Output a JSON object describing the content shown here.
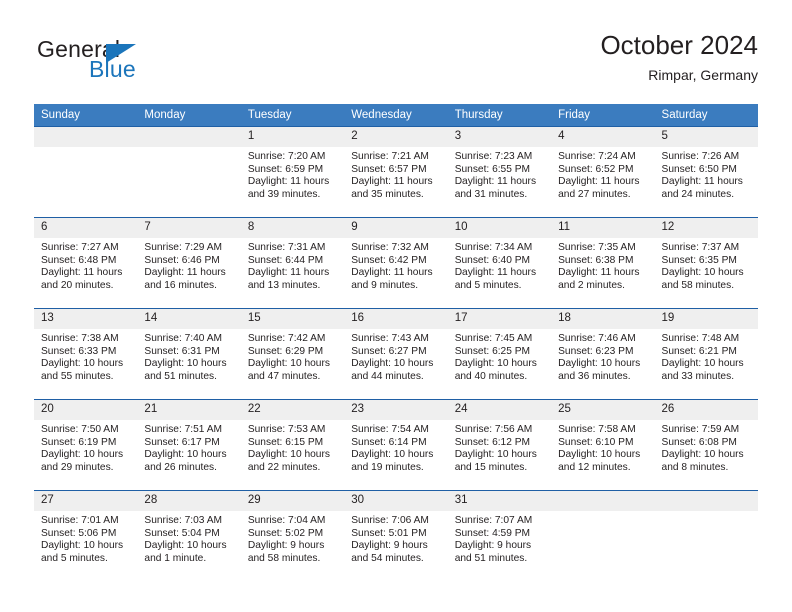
{
  "logo": {
    "primary_text": "General",
    "secondary_text": "Blue",
    "triangle_color": "#1b75bb",
    "primary_color": "#231f20",
    "secondary_color": "#1b75bb"
  },
  "header": {
    "month_title": "October 2024",
    "location": "Rimpar, Germany"
  },
  "theme": {
    "header_blue": "#3b7cbf",
    "separator_blue": "#1f5fa5",
    "daynum_band": "#efefef",
    "text": "#231f20"
  },
  "weekday_headers": [
    "Sunday",
    "Monday",
    "Tuesday",
    "Wednesday",
    "Thursday",
    "Friday",
    "Saturday"
  ],
  "weeks": [
    [
      {
        "day": "",
        "empty": true
      },
      {
        "day": "",
        "empty": true
      },
      {
        "day": "1",
        "sunrise": "Sunrise: 7:20 AM",
        "sunset": "Sunset: 6:59 PM",
        "daylight_line1": "Daylight: 11 hours",
        "daylight_line2": "and 39 minutes."
      },
      {
        "day": "2",
        "sunrise": "Sunrise: 7:21 AM",
        "sunset": "Sunset: 6:57 PM",
        "daylight_line1": "Daylight: 11 hours",
        "daylight_line2": "and 35 minutes."
      },
      {
        "day": "3",
        "sunrise": "Sunrise: 7:23 AM",
        "sunset": "Sunset: 6:55 PM",
        "daylight_line1": "Daylight: 11 hours",
        "daylight_line2": "and 31 minutes."
      },
      {
        "day": "4",
        "sunrise": "Sunrise: 7:24 AM",
        "sunset": "Sunset: 6:52 PM",
        "daylight_line1": "Daylight: 11 hours",
        "daylight_line2": "and 27 minutes."
      },
      {
        "day": "5",
        "sunrise": "Sunrise: 7:26 AM",
        "sunset": "Sunset: 6:50 PM",
        "daylight_line1": "Daylight: 11 hours",
        "daylight_line2": "and 24 minutes."
      }
    ],
    [
      {
        "day": "6",
        "sunrise": "Sunrise: 7:27 AM",
        "sunset": "Sunset: 6:48 PM",
        "daylight_line1": "Daylight: 11 hours",
        "daylight_line2": "and 20 minutes."
      },
      {
        "day": "7",
        "sunrise": "Sunrise: 7:29 AM",
        "sunset": "Sunset: 6:46 PM",
        "daylight_line1": "Daylight: 11 hours",
        "daylight_line2": "and 16 minutes."
      },
      {
        "day": "8",
        "sunrise": "Sunrise: 7:31 AM",
        "sunset": "Sunset: 6:44 PM",
        "daylight_line1": "Daylight: 11 hours",
        "daylight_line2": "and 13 minutes."
      },
      {
        "day": "9",
        "sunrise": "Sunrise: 7:32 AM",
        "sunset": "Sunset: 6:42 PM",
        "daylight_line1": "Daylight: 11 hours",
        "daylight_line2": "and 9 minutes."
      },
      {
        "day": "10",
        "sunrise": "Sunrise: 7:34 AM",
        "sunset": "Sunset: 6:40 PM",
        "daylight_line1": "Daylight: 11 hours",
        "daylight_line2": "and 5 minutes."
      },
      {
        "day": "11",
        "sunrise": "Sunrise: 7:35 AM",
        "sunset": "Sunset: 6:38 PM",
        "daylight_line1": "Daylight: 11 hours",
        "daylight_line2": "and 2 minutes."
      },
      {
        "day": "12",
        "sunrise": "Sunrise: 7:37 AM",
        "sunset": "Sunset: 6:35 PM",
        "daylight_line1": "Daylight: 10 hours",
        "daylight_line2": "and 58 minutes."
      }
    ],
    [
      {
        "day": "13",
        "sunrise": "Sunrise: 7:38 AM",
        "sunset": "Sunset: 6:33 PM",
        "daylight_line1": "Daylight: 10 hours",
        "daylight_line2": "and 55 minutes."
      },
      {
        "day": "14",
        "sunrise": "Sunrise: 7:40 AM",
        "sunset": "Sunset: 6:31 PM",
        "daylight_line1": "Daylight: 10 hours",
        "daylight_line2": "and 51 minutes."
      },
      {
        "day": "15",
        "sunrise": "Sunrise: 7:42 AM",
        "sunset": "Sunset: 6:29 PM",
        "daylight_line1": "Daylight: 10 hours",
        "daylight_line2": "and 47 minutes."
      },
      {
        "day": "16",
        "sunrise": "Sunrise: 7:43 AM",
        "sunset": "Sunset: 6:27 PM",
        "daylight_line1": "Daylight: 10 hours",
        "daylight_line2": "and 44 minutes."
      },
      {
        "day": "17",
        "sunrise": "Sunrise: 7:45 AM",
        "sunset": "Sunset: 6:25 PM",
        "daylight_line1": "Daylight: 10 hours",
        "daylight_line2": "and 40 minutes."
      },
      {
        "day": "18",
        "sunrise": "Sunrise: 7:46 AM",
        "sunset": "Sunset: 6:23 PM",
        "daylight_line1": "Daylight: 10 hours",
        "daylight_line2": "and 36 minutes."
      },
      {
        "day": "19",
        "sunrise": "Sunrise: 7:48 AM",
        "sunset": "Sunset: 6:21 PM",
        "daylight_line1": "Daylight: 10 hours",
        "daylight_line2": "and 33 minutes."
      }
    ],
    [
      {
        "day": "20",
        "sunrise": "Sunrise: 7:50 AM",
        "sunset": "Sunset: 6:19 PM",
        "daylight_line1": "Daylight: 10 hours",
        "daylight_line2": "and 29 minutes."
      },
      {
        "day": "21",
        "sunrise": "Sunrise: 7:51 AM",
        "sunset": "Sunset: 6:17 PM",
        "daylight_line1": "Daylight: 10 hours",
        "daylight_line2": "and 26 minutes."
      },
      {
        "day": "22",
        "sunrise": "Sunrise: 7:53 AM",
        "sunset": "Sunset: 6:15 PM",
        "daylight_line1": "Daylight: 10 hours",
        "daylight_line2": "and 22 minutes."
      },
      {
        "day": "23",
        "sunrise": "Sunrise: 7:54 AM",
        "sunset": "Sunset: 6:14 PM",
        "daylight_line1": "Daylight: 10 hours",
        "daylight_line2": "and 19 minutes."
      },
      {
        "day": "24",
        "sunrise": "Sunrise: 7:56 AM",
        "sunset": "Sunset: 6:12 PM",
        "daylight_line1": "Daylight: 10 hours",
        "daylight_line2": "and 15 minutes."
      },
      {
        "day": "25",
        "sunrise": "Sunrise: 7:58 AM",
        "sunset": "Sunset: 6:10 PM",
        "daylight_line1": "Daylight: 10 hours",
        "daylight_line2": "and 12 minutes."
      },
      {
        "day": "26",
        "sunrise": "Sunrise: 7:59 AM",
        "sunset": "Sunset: 6:08 PM",
        "daylight_line1": "Daylight: 10 hours",
        "daylight_line2": "and 8 minutes."
      }
    ],
    [
      {
        "day": "27",
        "sunrise": "Sunrise: 7:01 AM",
        "sunset": "Sunset: 5:06 PM",
        "daylight_line1": "Daylight: 10 hours",
        "daylight_line2": "and 5 minutes."
      },
      {
        "day": "28",
        "sunrise": "Sunrise: 7:03 AM",
        "sunset": "Sunset: 5:04 PM",
        "daylight_line1": "Daylight: 10 hours",
        "daylight_line2": "and 1 minute."
      },
      {
        "day": "29",
        "sunrise": "Sunrise: 7:04 AM",
        "sunset": "Sunset: 5:02 PM",
        "daylight_line1": "Daylight: 9 hours",
        "daylight_line2": "and 58 minutes."
      },
      {
        "day": "30",
        "sunrise": "Sunrise: 7:06 AM",
        "sunset": "Sunset: 5:01 PM",
        "daylight_line1": "Daylight: 9 hours",
        "daylight_line2": "and 54 minutes."
      },
      {
        "day": "31",
        "sunrise": "Sunrise: 7:07 AM",
        "sunset": "Sunset: 4:59 PM",
        "daylight_line1": "Daylight: 9 hours",
        "daylight_line2": "and 51 minutes."
      },
      {
        "day": "",
        "empty": true
      },
      {
        "day": "",
        "empty": true
      }
    ]
  ]
}
